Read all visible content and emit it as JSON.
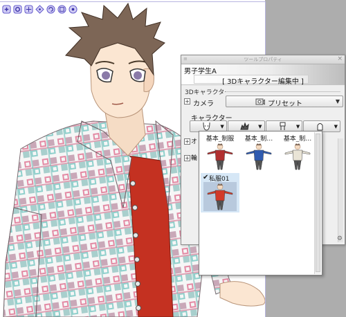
{
  "panel": {
    "title": "ツールプロパティ",
    "tool_name": "男子学生A",
    "edit_mode": "[ 3Dキャラクター編集中 ]",
    "section_3d": "3Dキャラクター",
    "camera_label": "カメラ",
    "camera_value": "プリセット",
    "character_label": "キャラクター",
    "collapsed_row_1": "オ",
    "collapsed_row_2": "輪"
  },
  "popup": {
    "items": [
      {
        "label": "基本_制服",
        "outfit_color": "#b22f2f"
      },
      {
        "label": "基本_制…",
        "outfit_color": "#2f5bb0"
      },
      {
        "label": "基本_制…",
        "outfit_color": "#e9e4d6"
      },
      {
        "label": "私服01",
        "outfit_color": "#d23a2a",
        "selected": true
      }
    ],
    "check": "✔"
  },
  "icons": {
    "manipulator": [
      "move-icon",
      "rotate-icon",
      "pan-icon",
      "camera-move-icon",
      "rotate-object-icon",
      "scale-icon",
      "dolly-icon"
    ],
    "char_buttons": [
      "face-icon",
      "hair-icon",
      "body-icon",
      "accessory-icon"
    ]
  }
}
